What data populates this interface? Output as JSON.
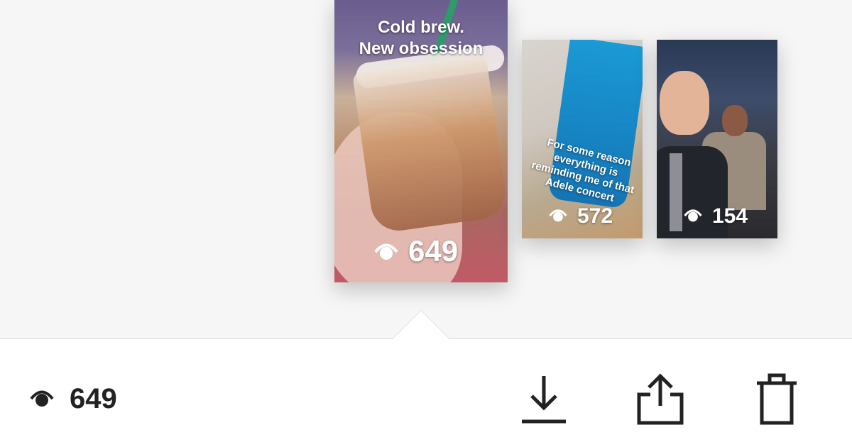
{
  "stories": [
    {
      "caption": "Cold brew.\nNew obsession",
      "views": "649"
    },
    {
      "caption": "For some reason\neverything is\nreminding me of that\nAdele concert",
      "views": "572"
    },
    {
      "caption": "",
      "views": "154"
    }
  ],
  "footer": {
    "views": "649",
    "actions": [
      {
        "icon": "download-icon"
      },
      {
        "icon": "share-icon"
      },
      {
        "icon": "trash-icon"
      }
    ]
  },
  "colors": {
    "background": "#f6f6f6",
    "bar": "#ffffff",
    "icon": "#222222"
  }
}
